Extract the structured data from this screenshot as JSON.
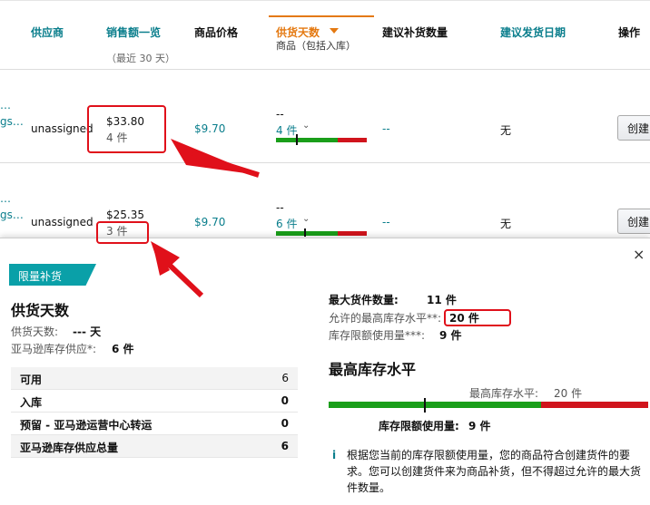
{
  "table": {
    "headers": {
      "supplier": "供应商",
      "sales": "销售额一览",
      "sales_sub": "（最近 30 天）",
      "price": "商品价格",
      "supply_days": "供货天数",
      "supply_sub": "商品（包括入库）",
      "suggested_qty": "建议补货数量",
      "suggested_date": "建议发货日期",
      "action": "操作"
    },
    "rows": [
      {
        "link_frag_a": "…",
        "link_frag_b": "gs…",
        "supplier": "unassigned",
        "sales": "$33.80",
        "units": "4 件",
        "price": "$9.70",
        "days": "--",
        "days_units": "4 件",
        "qty": "--",
        "date": "无",
        "button": "创建"
      },
      {
        "link_frag_a": "…",
        "link_frag_b": "gs…",
        "supplier": "unassigned",
        "sales": "$25.35",
        "units": "3 件",
        "price": "$9.70",
        "days": "--",
        "days_units": "6 件",
        "qty": "--",
        "date": "无",
        "button": "创建"
      }
    ]
  },
  "panel": {
    "badge": "限量补货",
    "close": "×",
    "title": "供货天数",
    "supply_days_label": "供货天数:",
    "supply_days_value": "--- 天",
    "amazon_supply_label": "亚马逊库存供应*:",
    "amazon_supply_value": "6 件",
    "inventory": [
      {
        "label": "可用",
        "value": "6"
      },
      {
        "label": "入库",
        "value": "0"
      },
      {
        "label": "预留 - 亚马逊运营中心转运",
        "value": "0"
      },
      {
        "label": "亚马逊库存供应总量",
        "value": "6"
      }
    ],
    "max_qty_label": "最大货件数量:",
    "max_qty_value": "11 件",
    "allowed_max_label": "允许的最高库存水平**:",
    "allowed_max_value": "20 件",
    "usage_label": "库存限额使用量***:",
    "usage_value": "9 件",
    "max_level_title": "最高库存水平",
    "bar_top_label": "最高库存水平:",
    "bar_top_value": "20 件",
    "bar_bottom_label": "库存限额使用量:",
    "bar_bottom_value": "9 件",
    "info_icon": "i",
    "info_text": "根据您当前的库存限额使用量，您的商品符合创建货件的要求。您可以创建货件来为商品补货，但不得超过允许的最大货件数量。"
  },
  "colors": {
    "teal": "#0a7e8c",
    "orange": "#e47911",
    "green": "#1a9e1a",
    "red": "#d0141c",
    "badge": "#0aa0a8"
  }
}
